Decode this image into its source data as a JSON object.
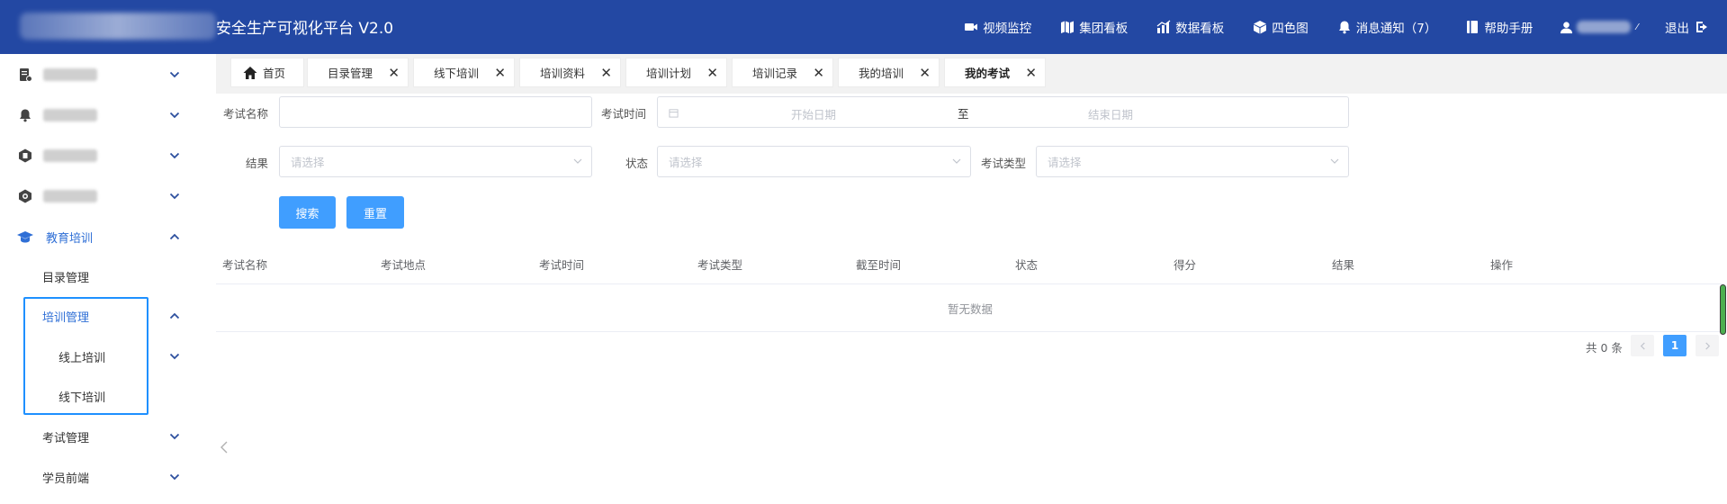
{
  "header": {
    "title": "安全生产可视化平台  V2.0",
    "nav": [
      {
        "label": "视频监控",
        "icon": "video-camera-icon"
      },
      {
        "label": "集团看板",
        "icon": "map-icon"
      },
      {
        "label": "数据看板",
        "icon": "chart-icon"
      },
      {
        "label": "四色图",
        "icon": "cube-icon"
      },
      {
        "label": "消息通知（7）",
        "icon": "bell-icon"
      },
      {
        "label": "帮助手册",
        "icon": "book-icon"
      }
    ],
    "logout": "退出"
  },
  "sidebar": {
    "education": "教育培训",
    "catalog": "目录管理",
    "training_mgmt": "培训管理",
    "online_training": "线上培训",
    "offline_training": "线下培训",
    "exam_mgmt": "考试管理",
    "student_front": "学员前端"
  },
  "tabs": [
    {
      "label": "首页"
    },
    {
      "label": "目录管理"
    },
    {
      "label": "线下培训"
    },
    {
      "label": "培训资料"
    },
    {
      "label": "培训计划"
    },
    {
      "label": "培训记录"
    },
    {
      "label": "我的培训"
    },
    {
      "label": "我的考试"
    }
  ],
  "form": {
    "exam_name_label": "考试名称",
    "exam_time_label": "考试时间",
    "start_date_placeholder": "开始日期",
    "range_separator": "至",
    "end_date_placeholder": "结束日期",
    "result_label": "结果",
    "status_label": "状态",
    "exam_type_label": "考试类型",
    "select_placeholder": "请选择",
    "search_button": "搜索",
    "reset_button": "重置"
  },
  "table": {
    "columns": [
      "考试名称",
      "考试地点",
      "考试时间",
      "考试类型",
      "截至时间",
      "状态",
      "得分",
      "结果",
      "操作"
    ],
    "empty_text": "暂无数据"
  },
  "pagination": {
    "total": "共 0 条",
    "current_page": "1"
  }
}
